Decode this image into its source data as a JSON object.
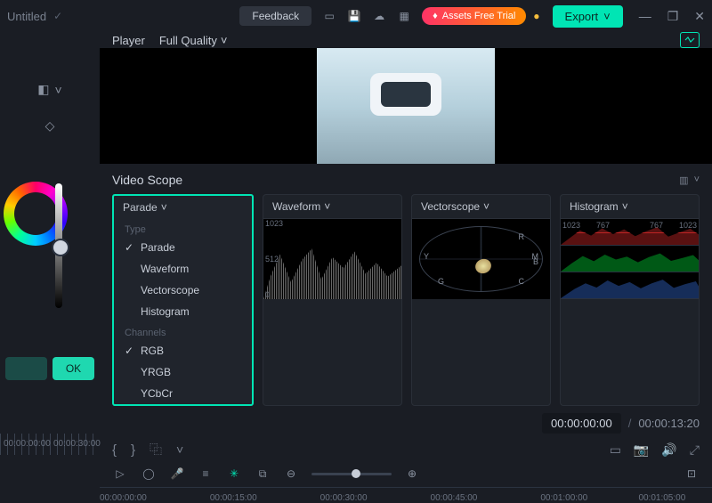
{
  "titlebar": {
    "title": "Untitled",
    "feedback": "Feedback",
    "assets": "Assets Free Trial",
    "export": "Export"
  },
  "player": {
    "label": "Player",
    "quality": "Full Quality"
  },
  "scope": {
    "title": "Video Scope",
    "panels": {
      "parade": "Parade",
      "waveform": "Waveform",
      "vectorscope": "Vectorscope",
      "histogram": "Histogram"
    },
    "dropdown": {
      "type_label": "Type",
      "channels_label": "Channels",
      "type_items": [
        "Parade",
        "Waveform",
        "Vectorscope",
        "Histogram"
      ],
      "type_selected": "Parade",
      "channel_items": [
        "RGB",
        "YRGB",
        "YCbCr"
      ],
      "channel_selected": "RGB"
    },
    "waveform_ticks": [
      "1023",
      "512",
      "0"
    ],
    "histogram_ticks": [
      "1023",
      "767",
      "767",
      "1023"
    ],
    "vs_labels": [
      "R",
      "M",
      "B",
      "C",
      "G",
      "Y"
    ]
  },
  "timecode": {
    "current": "00:00:00:00",
    "separator": "/",
    "duration": "00:00:13:20"
  },
  "ruler": [
    "00:00:00:00",
    "00:00:30:00",
    "00:00:15:00",
    "00:00:30:00",
    "00:00:45:00",
    "",
    "00:00:45:00",
    "",
    "00:01:00:00",
    "",
    "00:01:05:00"
  ],
  "left_panel": {
    "ok": "OK"
  }
}
